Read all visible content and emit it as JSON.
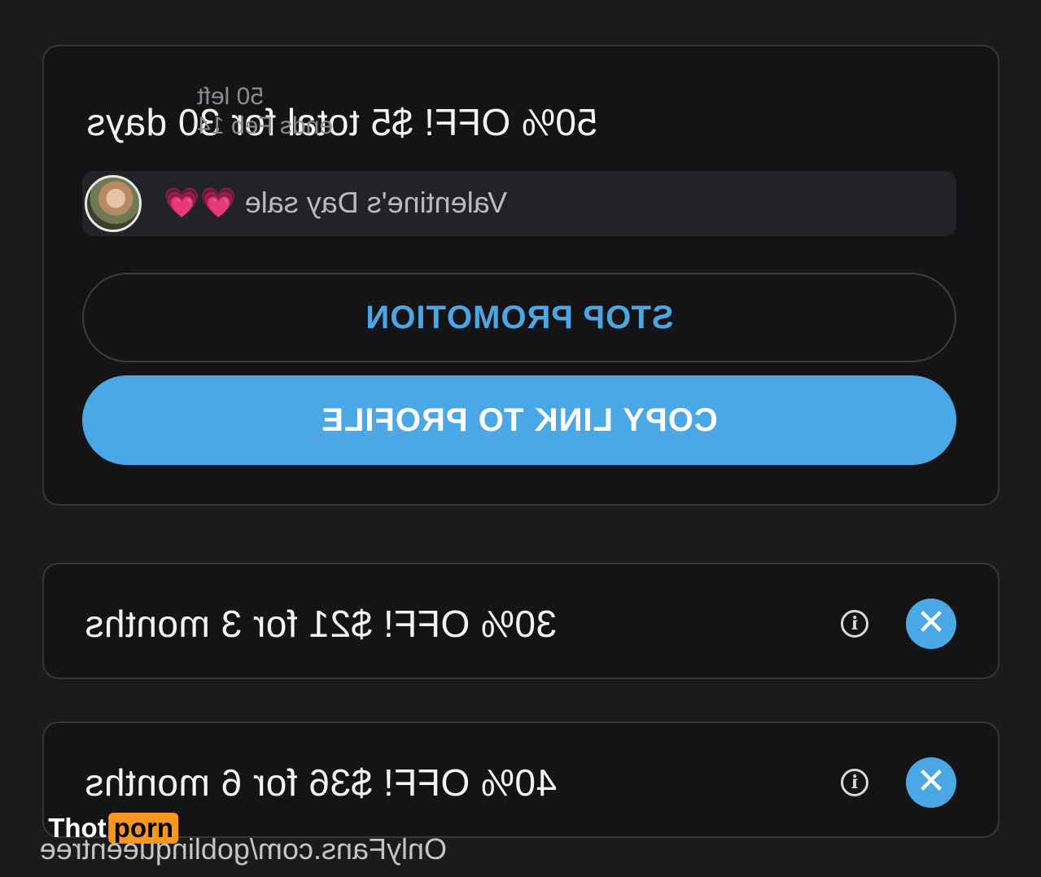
{
  "promo_main": {
    "title": "50% OFF! $5 total for 30 days",
    "remaining": "50 left",
    "expires": "ends Feb 14",
    "message": "Valentine's Day sale",
    "message_emoji": "💗💗",
    "stop_label": "STOP PROMOTION",
    "copy_label": "COPY LINK TO PROFILE"
  },
  "bundles": [
    {
      "title": "30% OFF!  $21 for 3 months"
    },
    {
      "title": "40% OFF!  $36 for 6 months"
    }
  ],
  "icons": {
    "close": "close-icon",
    "info": "info-icon"
  },
  "watermark": "OnlyFans.com/goblinqueentree",
  "logo": {
    "part1": "Thot",
    "part2": "porn"
  },
  "colors": {
    "accent": "#4ba8e6",
    "background": "#1b1b1d",
    "card": "#141416",
    "logo_orange": "#f7971c"
  }
}
